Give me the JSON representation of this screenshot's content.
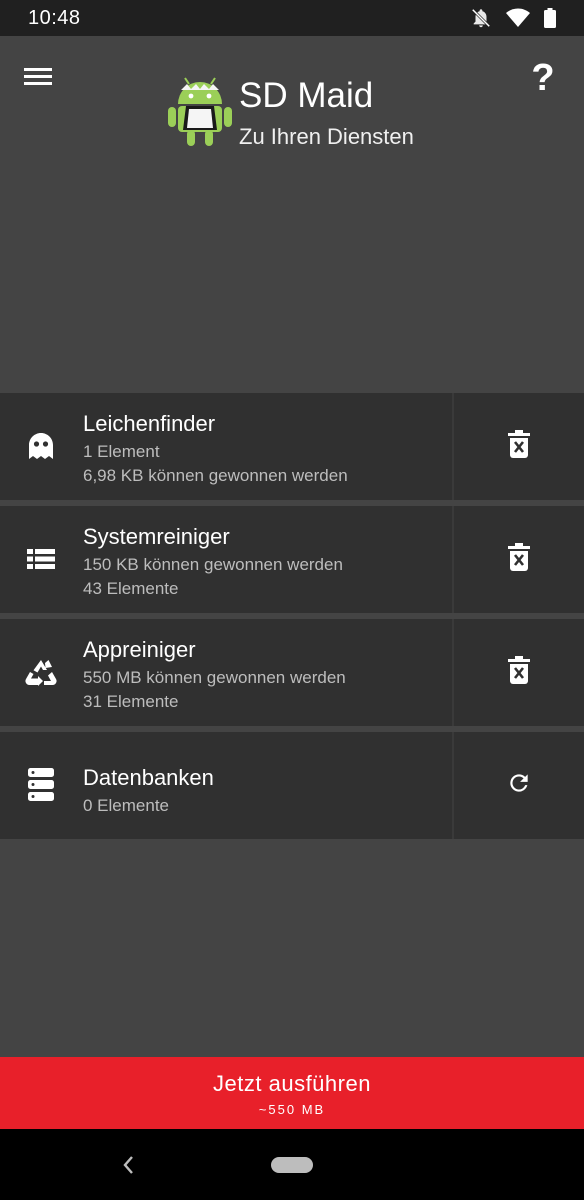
{
  "status_bar": {
    "time": "10:48",
    "icons": [
      "notifications-off-icon",
      "wifi-icon",
      "battery-icon"
    ]
  },
  "header": {
    "menu_icon": "hamburger-menu-icon",
    "help_label": "?",
    "logo_icon": "android-maid-logo",
    "title": "SD Maid",
    "subtitle": "Zu Ihren Diensten"
  },
  "tools": [
    {
      "icon": "ghost-icon",
      "title": "Leichenfinder",
      "line1": "1 Element",
      "line2": "6,98 KB können gewonnen werden",
      "action_icon": "delete-icon"
    },
    {
      "icon": "list-icon",
      "title": "Systemreiniger",
      "line1": "150 KB können gewonnen werden",
      "line2": "43 Elemente",
      "action_icon": "delete-icon"
    },
    {
      "icon": "recycle-icon",
      "title": "Appreiniger",
      "line1": "550 MB können gewonnen werden",
      "line2": "31 Elemente",
      "action_icon": "delete-icon"
    },
    {
      "icon": "database-icon",
      "title": "Datenbanken",
      "line1": "0 Elemente",
      "action_icon": "refresh-icon"
    }
  ],
  "run_button": {
    "label": "Jetzt ausführen",
    "size": "~550 MB"
  },
  "colors": {
    "accent": "#e8202a",
    "background": "#444444",
    "card": "#303030",
    "status_bar": "#202020"
  },
  "nav_bar": {
    "icons": [
      "back-icon",
      "home-pill"
    ]
  }
}
